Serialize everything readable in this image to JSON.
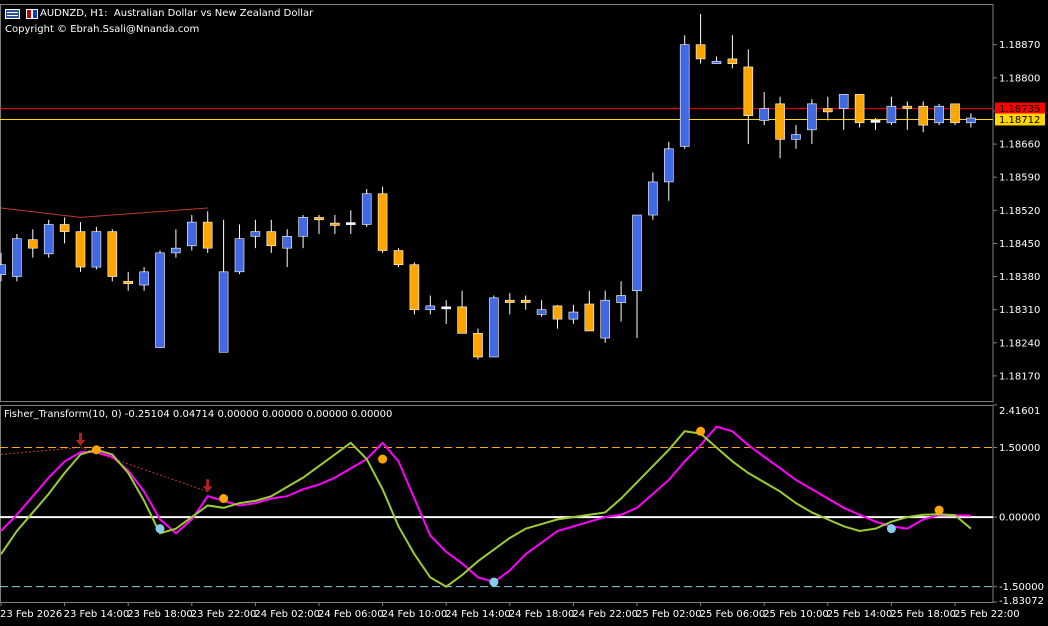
{
  "header": {
    "symbol": "AUDNZD",
    "timeframe": "H1",
    "description": "Australian Dollar vs New Zealand Dollar",
    "copyright": "Copyright © Ebrah.Ssali@Nnanda.com"
  },
  "indicator": {
    "label": "Fisher_Transform(10, 0) -0.25104 0.04714 0.00000 0.00000 0.00000 0.00000",
    "max_label": "2.41601",
    "min_label": "-1.83072"
  },
  "colors": {
    "background": "#000000",
    "bull_candle": "#4169E1",
    "bear_candle": "#FFA500",
    "doji": "#FFFFFF",
    "wick": "#FFFFFF",
    "grid": "#808080",
    "price_line_red": "#FF0000",
    "price_line_yellow": "#FFD700",
    "fisher_line": "#FF00FF",
    "trigger_line": "#9ACD32",
    "upper_level": "#FFA500",
    "lower_level": "#87CEEB",
    "zero_level": "#FFFFFF",
    "buy_dot": "#87CEEB",
    "sell_dot": "#FFA500",
    "arrow": "#B22222"
  },
  "chart_data": [
    {
      "type": "candlestick",
      "title": "AUDNZD, H1: Australian Dollar vs New Zealand Dollar",
      "y_ticks": [
        1.1817,
        1.1824,
        1.1831,
        1.1838,
        1.1845,
        1.1852,
        1.1859,
        1.1866,
        1.1873,
        1.188,
        1.1887
      ],
      "y_tick_labels": [
        "1.18170",
        "1.18240",
        "1.18310",
        "1.18380",
        "1.18450",
        "1.18520",
        "1.18590",
        "1.18660",
        "1.18730",
        "1.18800",
        "1.18870"
      ],
      "ylim": [
        1.18117,
        1.18956
      ],
      "price_labels": [
        {
          "label": "1.18735",
          "value": 1.18735,
          "color": "#FF0000"
        },
        {
          "label": "1.18712",
          "value": 1.18712,
          "color": "#FFD700"
        }
      ],
      "candles": [
        {
          "o": 1.18384,
          "h": 1.1843,
          "l": 1.1837,
          "c": 1.18405
        },
        {
          "o": 1.1838,
          "h": 1.1847,
          "l": 1.1837,
          "c": 1.1846
        },
        {
          "o": 1.18458,
          "h": 1.1848,
          "l": 1.1842,
          "c": 1.1844
        },
        {
          "o": 1.18428,
          "h": 1.185,
          "l": 1.1842,
          "c": 1.1849
        },
        {
          "o": 1.1849,
          "h": 1.18505,
          "l": 1.1845,
          "c": 1.18475
        },
        {
          "o": 1.18475,
          "h": 1.18495,
          "l": 1.1839,
          "c": 1.184
        },
        {
          "o": 1.184,
          "h": 1.18485,
          "l": 1.18395,
          "c": 1.18475
        },
        {
          "o": 1.18475,
          "h": 1.1848,
          "l": 1.1837,
          "c": 1.1838
        },
        {
          "o": 1.1837,
          "h": 1.1839,
          "l": 1.1835,
          "c": 1.18365
        },
        {
          "o": 1.18362,
          "h": 1.184,
          "l": 1.1835,
          "c": 1.1839
        },
        {
          "o": 1.1823,
          "h": 1.18435,
          "l": 1.1823,
          "c": 1.1843
        },
        {
          "o": 1.1843,
          "h": 1.1848,
          "l": 1.1842,
          "c": 1.1844
        },
        {
          "o": 1.18445,
          "h": 1.1851,
          "l": 1.18435,
          "c": 1.18495
        },
        {
          "o": 1.18495,
          "h": 1.18518,
          "l": 1.1843,
          "c": 1.1844
        },
        {
          "o": 1.1822,
          "h": 1.185,
          "l": 1.1822,
          "c": 1.1839
        },
        {
          "o": 1.1839,
          "h": 1.1849,
          "l": 1.18385,
          "c": 1.1846
        },
        {
          "o": 1.18465,
          "h": 1.185,
          "l": 1.1844,
          "c": 1.18475
        },
        {
          "o": 1.18475,
          "h": 1.185,
          "l": 1.1843,
          "c": 1.18445
        },
        {
          "o": 1.1844,
          "h": 1.1848,
          "l": 1.184,
          "c": 1.18465
        },
        {
          "o": 1.18465,
          "h": 1.1851,
          "l": 1.1844,
          "c": 1.18505
        },
        {
          "o": 1.18505,
          "h": 1.1851,
          "l": 1.1847,
          "c": 1.185
        },
        {
          "o": 1.18493,
          "h": 1.1851,
          "l": 1.1847,
          "c": 1.18488
        },
        {
          "o": 1.18493,
          "h": 1.1852,
          "l": 1.1847,
          "c": 1.18494
        },
        {
          "o": 1.1849,
          "h": 1.18565,
          "l": 1.18485,
          "c": 1.18555
        },
        {
          "o": 1.18555,
          "h": 1.1857,
          "l": 1.1843,
          "c": 1.18435
        },
        {
          "o": 1.18435,
          "h": 1.1844,
          "l": 1.184,
          "c": 1.18405
        },
        {
          "o": 1.18405,
          "h": 1.1841,
          "l": 1.183,
          "c": 1.1831
        },
        {
          "o": 1.1831,
          "h": 1.1834,
          "l": 1.183,
          "c": 1.18318
        },
        {
          "o": 1.18315,
          "h": 1.1833,
          "l": 1.1828,
          "c": 1.18316
        },
        {
          "o": 1.18316,
          "h": 1.1835,
          "l": 1.1826,
          "c": 1.1826
        },
        {
          "o": 1.1826,
          "h": 1.1827,
          "l": 1.18205,
          "c": 1.1821
        },
        {
          "o": 1.1821,
          "h": 1.1834,
          "l": 1.1821,
          "c": 1.18335
        },
        {
          "o": 1.1833,
          "h": 1.18345,
          "l": 1.183,
          "c": 1.18325
        },
        {
          "o": 1.1833,
          "h": 1.1834,
          "l": 1.1831,
          "c": 1.18325
        },
        {
          "o": 1.183,
          "h": 1.1833,
          "l": 1.18295,
          "c": 1.1831
        },
        {
          "o": 1.18318,
          "h": 1.1832,
          "l": 1.1827,
          "c": 1.1829
        },
        {
          "o": 1.1829,
          "h": 1.1832,
          "l": 1.1828,
          "c": 1.18305
        },
        {
          "o": 1.18322,
          "h": 1.1835,
          "l": 1.1828,
          "c": 1.18265
        },
        {
          "o": 1.1825,
          "h": 1.1835,
          "l": 1.1824,
          "c": 1.1833
        },
        {
          "o": 1.18325,
          "h": 1.1837,
          "l": 1.18285,
          "c": 1.1834
        },
        {
          "o": 1.1835,
          "h": 1.1851,
          "l": 1.1825,
          "c": 1.1851
        },
        {
          "o": 1.1851,
          "h": 1.186,
          "l": 1.185,
          "c": 1.1858
        },
        {
          "o": 1.1858,
          "h": 1.18665,
          "l": 1.1854,
          "c": 1.1865
        },
        {
          "o": 1.18655,
          "h": 1.1889,
          "l": 1.1865,
          "c": 1.1887
        },
        {
          "o": 1.1887,
          "h": 1.18935,
          "l": 1.1883,
          "c": 1.1884
        },
        {
          "o": 1.1883,
          "h": 1.18845,
          "l": 1.1883,
          "c": 1.18835
        },
        {
          "o": 1.1884,
          "h": 1.1889,
          "l": 1.1882,
          "c": 1.1883
        },
        {
          "o": 1.18823,
          "h": 1.1886,
          "l": 1.1866,
          "c": 1.1872
        },
        {
          "o": 1.1871,
          "h": 1.1877,
          "l": 1.187,
          "c": 1.18735
        },
        {
          "o": 1.18745,
          "h": 1.1876,
          "l": 1.1863,
          "c": 1.1867
        },
        {
          "o": 1.1867,
          "h": 1.187,
          "l": 1.1865,
          "c": 1.1868
        },
        {
          "o": 1.1869,
          "h": 1.18755,
          "l": 1.1866,
          "c": 1.18745
        },
        {
          "o": 1.18735,
          "h": 1.1876,
          "l": 1.1871,
          "c": 1.18728
        },
        {
          "o": 1.18735,
          "h": 1.18765,
          "l": 1.1869,
          "c": 1.18765
        },
        {
          "o": 1.18765,
          "h": 1.18765,
          "l": 1.18695,
          "c": 1.18705
        },
        {
          "o": 1.1871,
          "h": 1.18715,
          "l": 1.1869,
          "c": 1.1871
        },
        {
          "o": 1.18705,
          "h": 1.1876,
          "l": 1.187,
          "c": 1.1874
        },
        {
          "o": 1.1874,
          "h": 1.1875,
          "l": 1.1869,
          "c": 1.18735
        },
        {
          "o": 1.1874,
          "h": 1.1875,
          "l": 1.18685,
          "c": 1.187
        },
        {
          "o": 1.18705,
          "h": 1.18745,
          "l": 1.187,
          "c": 1.1874
        },
        {
          "o": 1.18745,
          "h": 1.18745,
          "l": 1.187,
          "c": 1.18705
        },
        {
          "o": 1.18705,
          "h": 1.18725,
          "l": 1.18695,
          "c": 1.18715
        }
      ],
      "trendline": {
        "from": {
          "candle": 0,
          "value": 1.18525
        },
        "via": {
          "candle": 5,
          "value": 1.18505
        },
        "to": {
          "candle": 13,
          "value": 1.18525
        }
      }
    },
    {
      "type": "line",
      "title": "Fisher_Transform(10, 0)",
      "y_ticks": [
        2.41601,
        1.5,
        0.0,
        -1.5,
        -1.83072
      ],
      "y_tick_labels": [
        "2.41601",
        "1.50000",
        "0.00000",
        "-1.50000",
        "-1.83072"
      ],
      "ylim": [
        -1.83072,
        2.41601
      ],
      "levels": [
        1.5,
        0.0,
        -1.5
      ],
      "series": [
        {
          "key": "fisher",
          "values": [
            -0.3,
            0.05,
            0.45,
            0.85,
            1.2,
            1.4,
            1.4,
            1.3,
            1.0,
            0.55,
            -0.05,
            -0.35,
            -0.05,
            0.45,
            0.35,
            0.25,
            0.3,
            0.4,
            0.45,
            0.6,
            0.7,
            0.85,
            1.05,
            1.25,
            1.6,
            1.2,
            0.4,
            -0.4,
            -0.75,
            -1.0,
            -1.3,
            -1.4,
            -1.15,
            -0.8,
            -0.55,
            -0.3,
            -0.2,
            -0.1,
            0.0,
            0.05,
            0.2,
            0.5,
            0.8,
            1.2,
            1.55,
            1.95,
            1.85,
            1.55,
            1.3,
            1.05,
            0.8,
            0.6,
            0.4,
            0.2,
            0.05,
            -0.1,
            -0.2,
            -0.25,
            -0.05,
            0.04,
            0.04,
            0.03
          ]
        },
        {
          "key": "trigger",
          "values": [
            -0.8,
            -0.3,
            0.1,
            0.5,
            0.95,
            1.35,
            1.45,
            1.35,
            0.95,
            0.35,
            -0.35,
            -0.25,
            0.0,
            0.25,
            0.2,
            0.3,
            0.35,
            0.45,
            0.65,
            0.85,
            1.1,
            1.35,
            1.6,
            1.25,
            0.6,
            -0.2,
            -0.8,
            -1.3,
            -1.5,
            -1.25,
            -0.95,
            -0.7,
            -0.45,
            -0.25,
            -0.15,
            -0.05,
            0.0,
            0.05,
            0.1,
            0.4,
            0.75,
            1.1,
            1.45,
            1.85,
            1.8,
            1.5,
            1.2,
            0.95,
            0.75,
            0.55,
            0.3,
            0.1,
            -0.05,
            -0.2,
            -0.3,
            -0.25,
            -0.1,
            0.0,
            0.05,
            0.06,
            0.04,
            -0.25
          ]
        }
      ],
      "sell_dots": [
        {
          "candle": 6,
          "value": 1.45
        },
        {
          "candle": 14,
          "value": 0.4
        },
        {
          "candle": 24,
          "value": 1.25
        },
        {
          "candle": 44,
          "value": 1.85
        },
        {
          "candle": 59,
          "value": 0.15
        }
      ],
      "buy_dots": [
        {
          "candle": 10,
          "value": -0.25
        },
        {
          "candle": 31,
          "value": -1.4
        },
        {
          "candle": 56,
          "value": -0.25
        }
      ],
      "arrows": [
        {
          "candle": 5,
          "value": 1.6
        },
        {
          "candle": 13,
          "value": 0.6
        }
      ],
      "trendline": {
        "from": {
          "candle": 0,
          "value": 1.35
        },
        "via": {
          "candle": 5,
          "value": 1.5
        },
        "to": {
          "candle": 13,
          "value": 0.55
        }
      }
    }
  ],
  "x_axis": {
    "labels": [
      "23 Feb 2026",
      "23 Feb 14:00",
      "23 Feb 18:00",
      "23 Feb 22:00",
      "24 Feb 02:00",
      "24 Feb 06:00",
      "24 Feb 10:00",
      "24 Feb 14:00",
      "24 Feb 18:00",
      "24 Feb 22:00",
      "25 Feb 02:00",
      "25 Feb 06:00",
      "25 Feb 10:00",
      "25 Feb 14:00",
      "25 Feb 18:00",
      "25 Feb 22:00"
    ]
  }
}
